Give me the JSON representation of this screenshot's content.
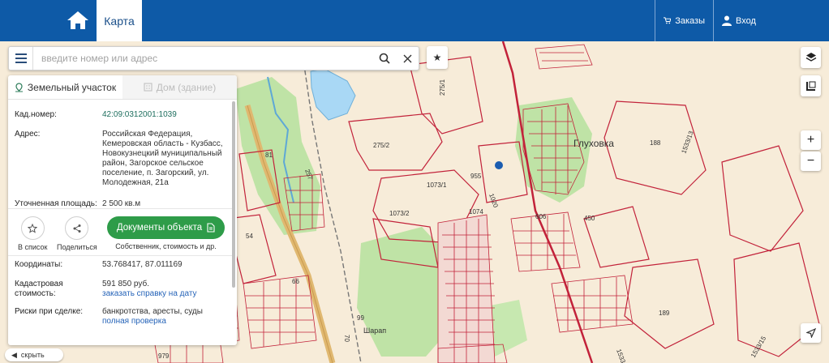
{
  "header": {
    "map_tab": "Карта",
    "orders_label": "Заказы",
    "login_label": "Вход"
  },
  "search": {
    "placeholder": "введите номер или адрес"
  },
  "panel": {
    "tabs": [
      {
        "label": "Земельный участок"
      },
      {
        "label": "Дом (здание)"
      }
    ],
    "cad_number_label": "Кад.номер:",
    "cad_number": "42:09:0312001:1039",
    "address_label": "Адрес:",
    "address": "Российская Федерация, Кемеровская область - Кузбасс, Новокузнецкий муниципальный район, Загорское сельское поселение, п. Загорский, ул. Молодежная, 21а",
    "area_label": "Уточненная площадь:",
    "area": "2 500 кв.м",
    "actions": {
      "add_to_list": "В список",
      "share": "Поделиться",
      "documents": "Документы объекта",
      "documents_sub": "Собственник, стоимость и др."
    },
    "coords_label": "Координаты:",
    "coords": "53.768417, 87.011169",
    "cad_value_label": "Кадастровая стоимость:",
    "cad_value": "591 850 руб.",
    "cad_value_link": "заказать справку на дату",
    "risks_label": "Риски при сделке:",
    "risks": "банкротства, аресты, суды",
    "risks_link": "полная проверка"
  },
  "map": {
    "place_label": "Глуховка",
    "village_label": "Шарап",
    "parcels": [
      "275/1",
      "275/2",
      "81",
      "257",
      "54",
      "66",
      "1073/1",
      "1073/2",
      "955",
      "1020",
      "1074",
      "606",
      "450",
      "188",
      "1533/13",
      "189",
      "1533/18",
      "99",
      "70",
      "979",
      "1533/15"
    ]
  },
  "controls": {
    "zoom_in": "+",
    "zoom_out": "−",
    "hide": "скрыть"
  },
  "colors": {
    "header_bg": "#0e5aa7",
    "button_green": "#2e9c49",
    "parcel_red": "#c2223a",
    "map_bg": "#f7ecd9",
    "forest_green": "#bfe3a6",
    "water": "#a9d8f5"
  }
}
